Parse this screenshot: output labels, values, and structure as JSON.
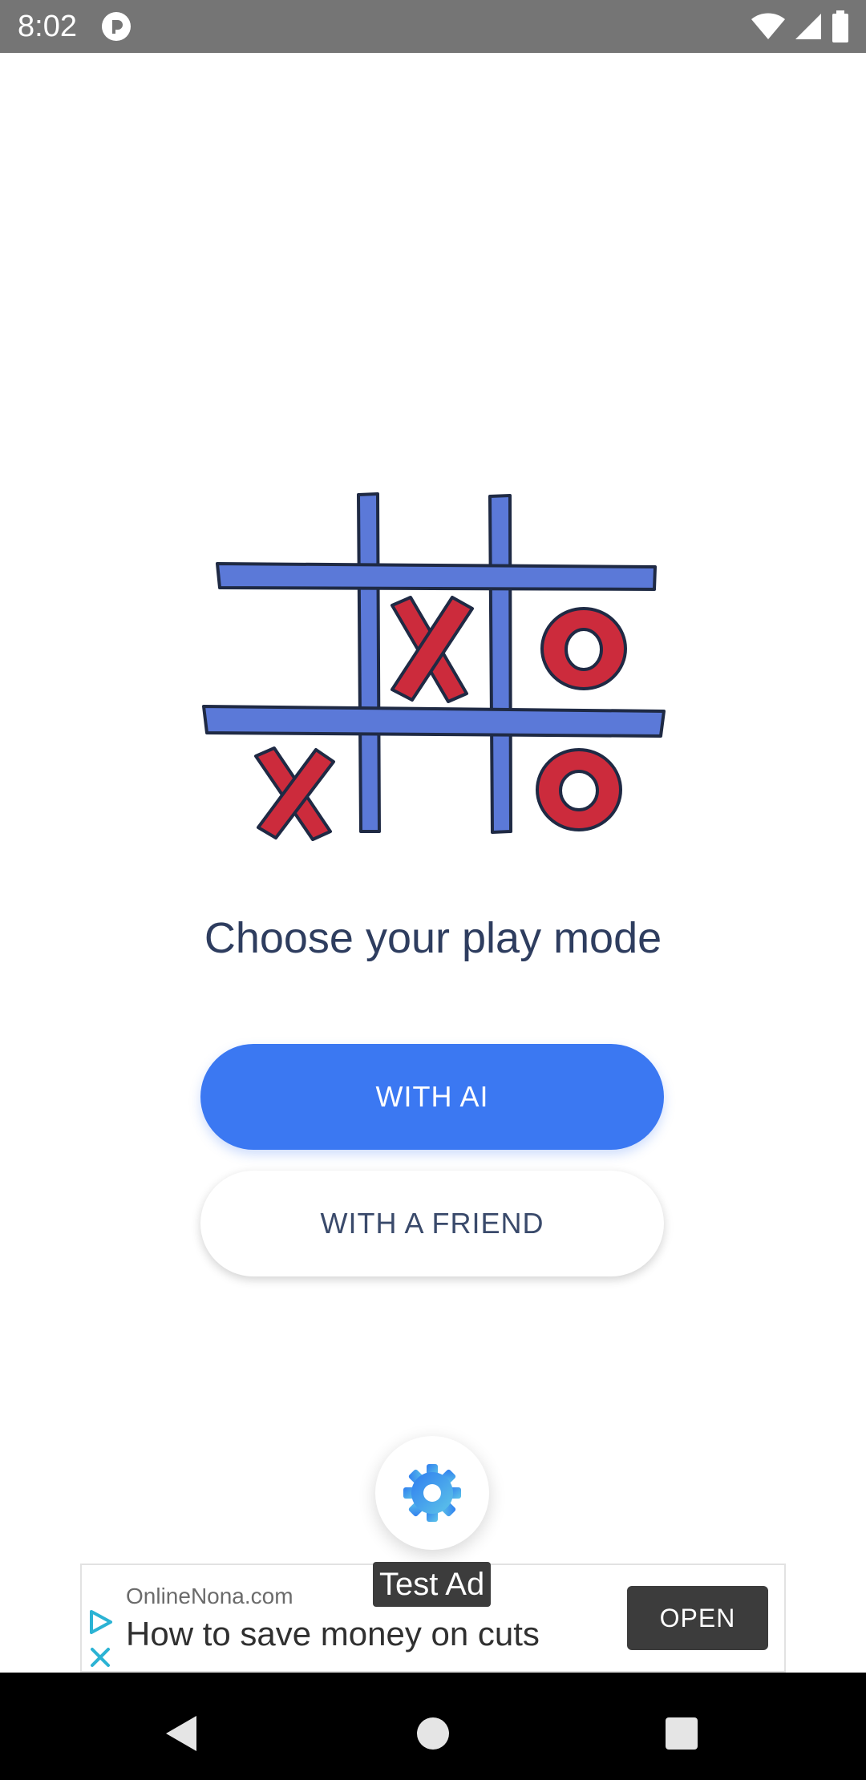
{
  "status_bar": {
    "time": "8:02",
    "icons": [
      "app-notification-icon",
      "wifi-icon",
      "signal-icon",
      "battery-icon"
    ]
  },
  "main": {
    "illustration": "tic-tac-toe-board-illustration",
    "headline": "Choose your play mode",
    "buttons": {
      "with_ai": "WITH AI",
      "with_friend": "WITH A FRIEND"
    },
    "settings_icon": "gear-icon"
  },
  "ad": {
    "label": "Test Ad",
    "domain": "OnlineNona.com",
    "headline": "How to save money on cuts",
    "open_label": "OPEN"
  },
  "nav_bar": {
    "icons": [
      "back-icon",
      "home-icon",
      "recents-icon"
    ]
  },
  "colors": {
    "accent": "#3b78f2",
    "headline_text": "#2e3d5f",
    "board_blue": "#5b79d8",
    "mark_red": "#cc2b3c"
  }
}
